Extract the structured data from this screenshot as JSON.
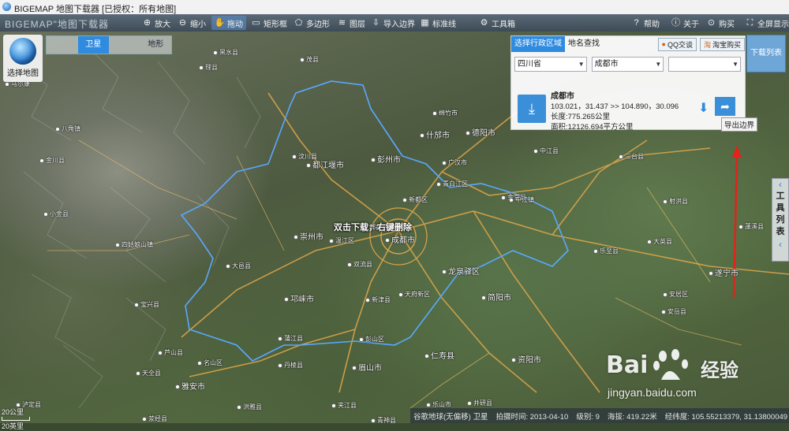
{
  "window": {
    "title": "BIGEMAP 地图下载器 [已授权：所有地图]"
  },
  "toolbar": {
    "brand": "BIGEMAP\"地图下载器",
    "items": [
      {
        "label": "放大",
        "icon": "zoom-in-icon"
      },
      {
        "label": "缩小",
        "icon": "zoom-out-icon"
      },
      {
        "label": "拖动",
        "icon": "hand-icon",
        "active": true
      },
      {
        "label": "矩形框",
        "icon": "rectangle-icon"
      },
      {
        "label": "多边形",
        "icon": "polygon-icon"
      },
      {
        "label": "图层",
        "icon": "layers-icon"
      },
      {
        "label": "导入边界",
        "icon": "import-icon"
      },
      {
        "label": "标准线",
        "icon": "ruler-icon"
      },
      {
        "label": "工具箱",
        "icon": "toolbox-icon"
      },
      {
        "label": "帮助",
        "icon": "help-icon"
      },
      {
        "label": "关于",
        "icon": "info-icon"
      },
      {
        "label": "购买",
        "icon": "cart-icon"
      },
      {
        "label": "全屏显示",
        "icon": "fullscreen-icon"
      }
    ]
  },
  "map_select": {
    "label": "选择地图"
  },
  "map_type": {
    "tabs": [
      "",
      "卫星",
      "",
      "地形"
    ],
    "active_index": 1
  },
  "panel": {
    "tabs": [
      "选择行政区域",
      "地名查找"
    ],
    "active_tab": 0,
    "qq_button": "QQ交谈",
    "taobao_button": "淘宝购买",
    "province": "四川省",
    "city": "成都市",
    "district": "",
    "region": {
      "name": "成都市",
      "bounds": "103.021，31.437 >> 104.890，30.096",
      "length": "长度:775.265公里",
      "area": "面积:12126.694平方公里"
    },
    "export_tooltip": "导出边界"
  },
  "download_list": "下载列表",
  "tools_list": {
    "chars": [
      "工",
      "具",
      "列",
      "表"
    ]
  },
  "center_hint": "双击下载，右键删除",
  "scale": {
    "top": "20公里",
    "bottom": "20英里"
  },
  "status": {
    "source": "谷歌地球(无偏移) 卫星",
    "date": "拍摄时间: 2013-04-10",
    "level": "级别: 9",
    "altitude": "海拔: 419.22米",
    "coords": "经纬度: 105.55213379, 31.13800049"
  },
  "watermark": {
    "brand": "Bai",
    "brand2": "经验",
    "url": "jingyan.baidu.com"
  },
  "places": [
    "茂县",
    "理县",
    "汶川县",
    "黑水县",
    "四姑娘山镇",
    "小金县",
    "八角镇",
    "金川县",
    "马尔康",
    "都江堰市",
    "彭州市",
    "什邡市",
    "绵竹市",
    "德阳市",
    "中江县",
    "广汉市",
    "新都区",
    "青白江区",
    "金堂县",
    "郫都区",
    "成都市",
    "崇州市",
    "温江区",
    "双流县",
    "新津县",
    "大邑县",
    "邛崃市",
    "蒲江县",
    "眉山市",
    "彭山区",
    "丹棱县",
    "洪雅县",
    "夹江县",
    "名山区",
    "雅安市",
    "芦山县",
    "天全县",
    "宝兴县",
    "简阳市",
    "资阳市",
    "乐至县",
    "安岳县",
    "遂宁市",
    "射洪县",
    "大英县",
    "三台县",
    "蓬溪县",
    "仁寿县",
    "井研县",
    "青神县",
    "龙泉驿区",
    "天府新区",
    "安居区",
    "乐山市",
    "中江镇",
    "泸定县",
    "荥经县"
  ]
}
